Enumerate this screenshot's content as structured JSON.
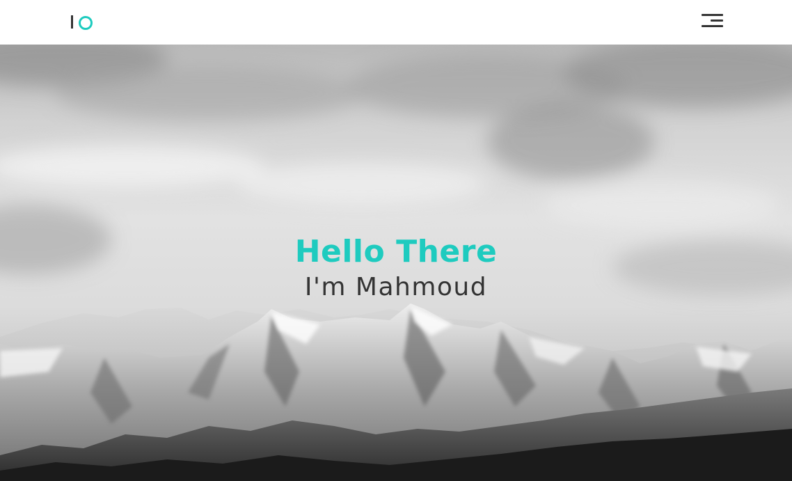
{
  "navbar": {
    "logo_icon": "io-logo-icon",
    "menu_icon": "hamburger-menu-icon"
  },
  "hero": {
    "background": "snowy-mountain-range-grayscale-image",
    "title": "Hello There",
    "subtitle": "I'm Mahmoud"
  },
  "colors": {
    "accent": "#1ecbbf",
    "text_dark": "#333333",
    "navbar_bg": "#ffffff"
  }
}
